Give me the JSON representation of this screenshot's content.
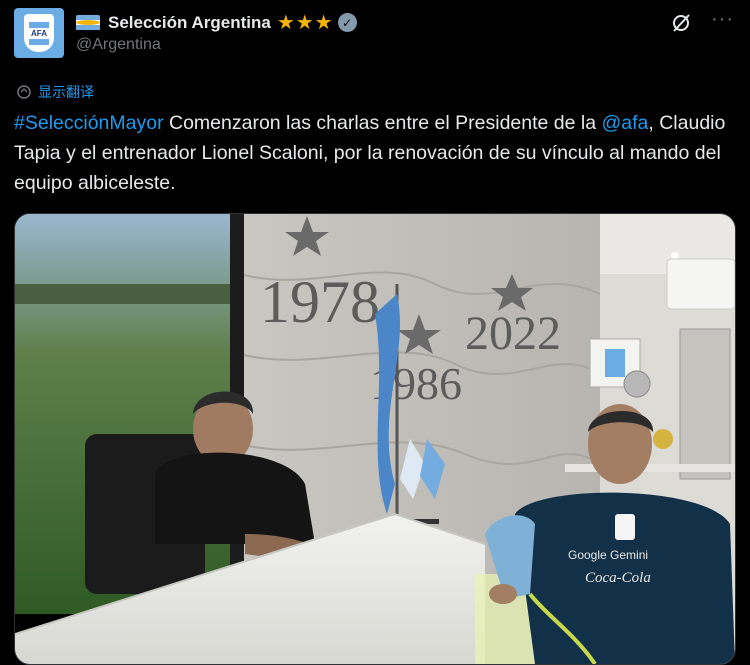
{
  "author": {
    "display_name": "Selección Argentina",
    "stars": "★★★",
    "handle": "@Argentina",
    "verified_icon": "verified-badge-icon",
    "avatar_icon": "afa-crest-icon",
    "flag_icon": "argentina-flag-icon"
  },
  "actions": {
    "grok_icon": "grok-icon",
    "more_label": "···"
  },
  "translate": {
    "label": "显示翻译"
  },
  "tweet": {
    "hashtag": "#SelecciónMayor",
    "text_1": " Comenzaron las charlas entre el Presidente de la ",
    "mention": "@afa",
    "text_2": ", Claudio Tapia y el entrenador Lionel Scaloni,  por la renovación de su vínculo al mando del equipo albiceleste."
  },
  "photo": {
    "wall_year_1": "1978",
    "wall_year_2": "1986",
    "wall_year_3": "2022",
    "shirt_sponsor_1": "Google Gemini",
    "shirt_sponsor_2": "Coca-Cola"
  },
  "colors": {
    "background": "#000000",
    "text": "#e7e9ea",
    "muted": "#71767b",
    "link": "#1d9bf0",
    "stars": "#f4b400"
  }
}
